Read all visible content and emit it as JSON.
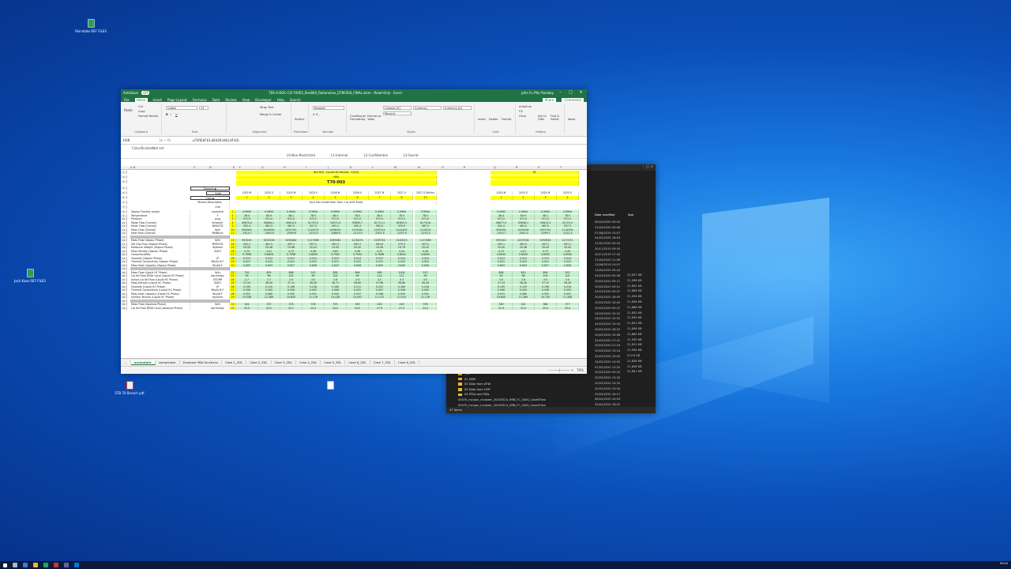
{
  "desktop": {
    "icons": [
      {
        "label": "Reinstate\nREF FILES",
        "style": "g"
      },
      {
        "label": "Jack Kaos\nREF FILES",
        "style": "g"
      },
      {
        "label": "STB 70\nBranch pdf",
        "style": "r"
      },
      {
        "label": "",
        "style": ""
      }
    ]
  },
  "excel": {
    "autosave": "AutoSave",
    "autosave_state": "Off",
    "title": "TEE-A-DOC-CD-70003_RevB04_Rationalise_DT80304_FINAL.xlsm - Read-Only - Excel",
    "user": "John Fu Pfor Rasiday",
    "menu": [
      "File",
      "Home",
      "Insert",
      "Page Layout",
      "Formulas",
      "Data",
      "Review",
      "View",
      "Developer",
      "Help",
      "Search"
    ],
    "share": "Share",
    "comments": "Comments",
    "ribbon": {
      "clipboard": "Clipboard",
      "cut": "Cut",
      "copy": "Copy",
      "format_painter": "Format Painter",
      "paste": "Paste",
      "font_name": "Calibri",
      "font_size": "11",
      "font": "Font",
      "alignment": "Alignment",
      "wrap": "Wrap Text",
      "merge": "Merge & Center",
      "protection": "Protection",
      "protect": "Protect",
      "number": "Number",
      "number_format": "Number",
      "styles": "Styles",
      "style1": "Comma [0]",
      "style2": "Currency",
      "style3": "Currency [0]",
      "style4": "Percent",
      "conditional": "Conditional Formatting",
      "format_table": "Format as Table",
      "cells": "Cells",
      "insert": "Insert",
      "delete": "Delete",
      "format": "Format",
      "editing": "Editing",
      "autosum": "AutoSum",
      "fill": "Fill",
      "clear": "Clear",
      "sort": "Sort & Filter",
      "find": "Find & Select",
      "ideas": "Ideas"
    },
    "name_box": "H18",
    "formula": "=FVIS($F$3,$E$18,H$3,$F$2)",
    "classification_label": "Classification:",
    "classification_value": "Not set",
    "class_tabs": [
      "L0-Non-Restricted",
      "L1-Internal",
      "L2-Confidential",
      "L3-Secret"
    ],
    "columns": [
      "A",
      "B",
      "C",
      "D",
      "E",
      "F",
      "G",
      "H",
      "I",
      "J",
      "K",
      "L",
      "M",
      "N",
      "O",
      "P",
      "Q",
      "R",
      "S",
      "T"
    ],
    "header_rows": {
      "rev": "Rev B04 - Issued for Review - F/S(4)",
      "hba": "HBA",
      "case_id": "T70-003",
      "streams": "Streams ▶",
      "case": "Case ▶",
      "code": "Code",
      "stream_desc": "Stream Description",
      "unit": "Unit",
      "sour_gas": "Sour Gas Outlet from Train 1 to AGR Trains",
      "q_col_code": "F8"
    },
    "year_codes": [
      "2025 M",
      "2025 S",
      "2025 M",
      "2025 S",
      "2026 M",
      "2026 S",
      "2027 M",
      "2027 S",
      "2027 S Stillhrs"
    ],
    "case_nums": [
      "1",
      "2",
      "3",
      "4",
      "5",
      "6",
      "7",
      "8",
      "13"
    ],
    "right_year_codes": [
      "2025 M",
      "2025 S",
      "2025 M",
      "2025 S"
    ],
    "right_case_nums": [
      "1",
      "2",
      "3",
      "4"
    ],
    "rows": [
      {
        "n": "8",
        "label": "Vapour Fraction (mole)",
        "unit": "mole/mol",
        "code": "1",
        "vals": [
          "0.9994",
          "0.9994",
          "0.9994",
          "0.9994",
          "0.9994",
          "0.9994",
          "0.9993",
          "0.9994",
          "0.9994"
        ],
        "r": [
          "0.9992",
          "0.9994",
          "0.9994",
          "0.9994"
        ],
        "style": "green"
      },
      {
        "n": "9",
        "label": "Temperature",
        "unit": "F",
        "code": "2",
        "vals": [
          "46.4",
          "80.9",
          "46.1",
          "78.5",
          "46.4",
          "78.5",
          "46.4",
          "78.5",
          "78.5"
        ],
        "r": [
          "46.4",
          "80.9",
          "46.1",
          "78.5"
        ],
        "style": "green"
      },
      {
        "n": "10",
        "label": "Pressure",
        "unit": "psig",
        "code": "3",
        "vals": [
          "971.0",
          "971.0",
          "971.0",
          "971.0",
          "971.0",
          "971.0",
          "971.0",
          "971.0",
          "971.0"
        ],
        "r": [
          "971.0",
          "971.0",
          "971.0",
          "971.0"
        ],
        "style": "green"
      },
      {
        "n": "11",
        "label": "Molar Flow (Overall)",
        "unit": "lbmole/h",
        "code": "4",
        "vals": [
          "49670.0",
          "50606.1",
          "50614.3",
          "51723.5",
          "54571.0",
          "55895.7",
          "61711.1",
          "62891.3",
          "61715.8"
        ],
        "r": [
          "49677.0",
          "50606.1",
          "50614.3",
          "51723.5"
        ],
        "style": "green"
      },
      {
        "n": "12",
        "label": "Molar Flow (Overall)",
        "unit": "MMSCFD",
        "code": "5",
        "vals": [
          "452.4",
          "461.5",
          "467.0",
          "507.3",
          "491.2",
          "505.4",
          "562.0",
          "570.9",
          "567.3"
        ],
        "r": [
          "452.4",
          "461.5",
          "467.0",
          "507.3"
        ],
        "style": "green"
      },
      {
        "n": "13",
        "label": "Mass Flow (Overall)",
        "unit": "lb/hr",
        "code": "10",
        "vals": [
          "994000",
          "1000000",
          "1051741",
          "1118722",
          "1094002",
          "1131942",
          "1197115",
          "1241403",
          "1118722"
        ],
        "r": [
          "994000",
          "1000194",
          "1051741",
          "1118790"
        ],
        "style": "green"
      },
      {
        "n": "14",
        "label": "Heat Flow (Overall)",
        "unit": "MMBtu/h",
        "code": "11",
        "vals": [
          "-1914.7",
          "-1940.9",
          "-2099.6",
          "-2152.5",
          "-2066.9",
          "-2110.5",
          "-2301.5",
          "-2337.9",
          "-2152.5"
        ],
        "r": [
          "-1914.7",
          "-1941.0",
          "-2099.7",
          "-2152.4"
        ],
        "style": "green"
      },
      {
        "n": "15",
        "label": "",
        "unit": "",
        "code": "",
        "vals": [
          "",
          "",
          "",
          "",
          "",
          "",
          "",
          "",
          ""
        ],
        "r": [
          "",
          "",
          "",
          ""
        ],
        "style": "grey"
      },
      {
        "n": "16",
        "label": "Mass Flow (Vapour Phase)",
        "unit": "lb/hr",
        "code": "13",
        "vals": [
          "993240",
          "1003190",
          "1050482",
          "1117469",
          "1083381",
          "1130474",
          "1195724",
          "1240013",
          "1117469"
        ],
        "r": [
          "993240",
          "1003194",
          "1050504",
          "1117472"
        ],
        "style": "green"
      },
      {
        "n": "17",
        "label": "Std Gas Flow (Vapour Phase)",
        "unit": "MMSCFD",
        "code": "14",
        "vals": [
          "452.1",
          "461.5",
          "497.1",
          "507.2",
          "491.3",
          "505.1",
          "561.6",
          "570.5",
          "507.2"
        ],
        "r": [
          "452.1",
          "461.5",
          "497.1",
          "507.2"
        ],
        "style": "green"
      },
      {
        "n": "18",
        "label": "Molecular Weight (Vapour Phase)",
        "unit": "lb/lbmol",
        "code": "15",
        "vals": [
          "20.00",
          "20.46",
          "19.98",
          "20.42",
          "19.43",
          "20.42",
          "19.40",
          "19.79",
          "20.42"
        ],
        "r": [
          "20.00",
          "20.46",
          "20.00",
          "20.42"
        ],
        "style": "green"
      },
      {
        "n": "19",
        "label": "Mass Density (Vapour Phase)",
        "unit": "lb/ft3",
        "code": "16",
        "vals": [
          "4.73",
          "4.21",
          "4.73",
          "4.26",
          "4.63",
          "4.26",
          "4.72",
          "4.24",
          "4.26"
        ],
        "r": [
          "4.73",
          "4.21",
          "4.73",
          "4.26"
        ],
        "style": "green"
      },
      {
        "n": "20",
        "label": "Compressibility",
        "unit": "-",
        "code": "17",
        "vals": [
          "0.7996",
          "0.8628",
          "0.7996",
          "0.8000",
          "0.7900",
          "0.7994",
          "0.7898",
          "0.8004",
          "0.8000"
        ],
        "r": [
          "0.8000",
          "0.8000",
          "0.8000",
          "0.8000"
        ],
        "style": "green"
      },
      {
        "n": "21",
        "label": "Viscosity (Vapour Phase)",
        "unit": "cP",
        "code": "18",
        "vals": [
          "0.013",
          "0.014",
          "0.013",
          "0.014",
          "0.013",
          "0.014",
          "0.013",
          "0.014",
          "0.014"
        ],
        "r": [
          "0.013",
          "0.014",
          "0.013",
          "0.014"
        ],
        "style": "green"
      },
      {
        "n": "22",
        "label": "Thermal Conductivity (Vapour Phase)",
        "unit": "Btu/hr.ft.F",
        "code": "19",
        "vals": [
          "0.021",
          "0.022",
          "0.021",
          "0.022",
          "0.021",
          "0.022",
          "0.021",
          "0.022",
          "0.022"
        ],
        "r": [
          "0.021",
          "0.022",
          "0.021",
          "0.022"
        ],
        "style": "green"
      },
      {
        "n": "23",
        "label": "Mass Heat Capacity (Vapour Phase)",
        "unit": "Btu/lb.F",
        "code": "20",
        "vals": [
          "0.653",
          "0.633",
          "0.627",
          "0.628",
          "0.647",
          "0.628",
          "0.650",
          "0.640",
          "0.628"
        ],
        "r": [
          "0.653",
          "0.633",
          "0.627",
          "0.628"
        ],
        "style": "green"
      },
      {
        "n": "24",
        "label": "",
        "unit": "",
        "code": "",
        "vals": [
          "",
          "",
          "",
          "",
          "",
          "",
          "",
          "",
          ""
        ],
        "r": [
          "",
          "",
          "",
          ""
        ],
        "style": "grey"
      },
      {
        "n": "25",
        "label": "Mass Flow (Liquid HC Phase)",
        "unit": "lb/hr",
        "code": "22",
        "vals": [
          "792",
          "803",
          "868",
          "913",
          "856",
          "899",
          "965",
          "1004",
          "913"
        ],
        "r": [
          "806",
          "850",
          "894",
          "933"
        ],
        "style": "green"
      },
      {
        "n": "26",
        "label": "Liq Vol Flow @Std Cond (Liquid HC Phase)",
        "unit": "barrel/day",
        "code": "23",
        "vals": [
          "93",
          "96",
          "102",
          "99",
          "102",
          "99",
          "114",
          "111",
          "99"
        ],
        "r": [
          "93",
          "96",
          "105",
          "102"
        ],
        "style": "green"
      },
      {
        "n": "27",
        "label": "Actual Liq Vol Flow (Liquid HC Phase)",
        "unit": "USGPM",
        "code": "24",
        "vals": [
          "2.7",
          "2.7",
          "2.9",
          "3.0",
          "2.8",
          "2.9",
          "3.2",
          "3.3",
          "3.0"
        ],
        "r": [
          "3.0",
          "2.8",
          "3.0",
          "3.0"
        ],
        "style": "green"
      },
      {
        "n": "28",
        "label": "Mass Density (Liquid HC Phase)",
        "unit": "lb/ft3",
        "code": "25",
        "vals": [
          "37.24",
          "36.40",
          "37.11",
          "36.49",
          "36.71",
          "36.60",
          "37.96",
          "36.80",
          "36.49"
        ],
        "r": [
          "37.24",
          "36.40",
          "37.11",
          "36.49"
        ],
        "style": "green"
      },
      {
        "n": "29",
        "label": "Viscosity (Liquid HC Phase)",
        "unit": "cP",
        "code": "26",
        "vals": [
          "0.195",
          "0.120",
          "0.196",
          "0.218",
          "0.189",
          "0.211",
          "0.222",
          "0.160",
          "0.218"
        ],
        "r": [
          "0.195",
          "0.120",
          "0.196",
          "0.218"
        ],
        "style": "green"
      },
      {
        "n": "30",
        "label": "Thermal Conductivity (Liquid HC Phase)",
        "unit": "Btu/hr.ft.F",
        "code": "27",
        "vals": [
          "0.056",
          "0.055",
          "0.056",
          "0.055",
          "0.056",
          "0.055",
          "0.057",
          "0.056",
          "0.055"
        ],
        "r": [
          "0.056",
          "0.055",
          "0.056",
          "0.055"
        ],
        "style": "green"
      },
      {
        "n": "31",
        "label": "Mass Heat Capacity (Liquid HC Phase)",
        "unit": "Btu/lb.F",
        "code": "28",
        "vals": [
          "0.551",
          "0.580",
          "0.552",
          "0.551",
          "0.555",
          "0.557",
          "0.548",
          "0.555",
          "0.551"
        ],
        "r": [
          "0.551",
          "0.580",
          "0.552",
          "0.551"
        ],
        "style": "green"
      },
      {
        "n": "32",
        "label": "Surface Tension (Liquid HC Phase)",
        "unit": "dyne/cm",
        "code": "29",
        "vals": [
          "19.358",
          "11.389",
          "19.630",
          "11.176",
          "19.438",
          "10.931",
          "11.172",
          "11.515",
          "11.176"
        ],
        "r": [
          "19.600",
          "11.389",
          "19.730",
          "11.308"
        ],
        "style": "green"
      },
      {
        "n": "33",
        "label": "",
        "unit": "",
        "code": "",
        "vals": [
          "",
          "",
          "",
          "",
          "",
          "",
          "",
          "",
          ""
        ],
        "r": [
          "",
          "",
          "",
          ""
        ],
        "style": "grey"
      },
      {
        "n": "34",
        "label": "Mass Flow (Aqueous Phase)",
        "unit": "lb/hr",
        "code": "31",
        "vals": [
          "342",
          "337",
          "376",
          "376",
          "375",
          "393",
          "416",
          "416",
          "376"
        ],
        "r": [
          "349",
          "342",
          "384",
          "377"
        ],
        "style": "green"
      },
      {
        "n": "35",
        "label": "Liq Vol Flow @Std Cond (Aqueous Phase)",
        "unit": "barrel/day",
        "code": "32",
        "vals": [
          "22.9",
          "22.2",
          "24.7",
          "24.4",
          "24.0",
          "24.0",
          "27.9",
          "27.3",
          "24.4"
        ],
        "r": [
          "22.9",
          "22.9",
          "25.0",
          "25.0"
        ],
        "style": "green"
      }
    ],
    "sheets": [
      "...",
      "usrInstallr",
      "comparator",
      "Example VBA functions",
      "Case 1_2DL",
      "Case 2_2DL",
      "Case 3_2DL",
      "Case 4_2DL",
      "Case 5_2DL",
      "Case 6_2DL",
      "Case 7_2DL",
      "Case 8_2DL"
    ],
    "active_sheet": 1,
    "zoom": "70%"
  },
  "explorer": {
    "column_header_date": "Date modified",
    "column_header_size": "Size",
    "dates": [
      "08/04/2020 09:03",
      "21/04/2020 09:08",
      "07/08/2019 15:07",
      "04/03/2020 16:04",
      "21/02/2020 09:54",
      "20/11/2019 09:30",
      "20/11/2019 17:43",
      "21/04/2020 11:08",
      "12/06/2019 10:57",
      "13/04/2020 09:43",
      "24/03/2020 09:28",
      "20/03/2020 09:21",
      "20/03/2020 09:51",
      "24/03/2020 09:47",
      "20/03/2020 16:05",
      "20/03/2020 10:40",
      "20/03/2020 09:47",
      "24/03/2020 10:32",
      "24/03/2020 10:52",
      "24/03/2020 10:33",
      "20/03/2020 16:52",
      "20/03/2020 10:08",
      "24/03/2020 17:41",
      "20/03/2020 21:18",
      "20/03/2020 10:24",
      "24/03/2020 14:00",
      "24/03/2020 14:00",
      "07/05/2020 15:52",
      "20/03/2020 09:20",
      "20/03/2020 13:34",
      "20/03/2020 14:30",
      "20/03/2020 19:34",
      "20/03/2020 16:27",
      "08/04/2020 10:03",
      "03/04/2020 16:02",
      "03/04/2020 16:15",
      "08/04/2020 16:21"
    ],
    "sizes": [
      "22,837 KB",
      "22,098 KB",
      "21,692 KB",
      "21,868 KB",
      "21,926 KB",
      "21,836 KB",
      "21,868 KB",
      "21,832 KB",
      "21,839 KB",
      "21,822 KB",
      "21,856 KB",
      "21,860 KB",
      "21,930 KB",
      "21,812 KB",
      "21,956 KB",
      "2,074 KB",
      "21,828 KB",
      "21,826 KB",
      "21,801 KB"
    ],
    "files": [
      {
        "name": "_old",
        "type": "folder"
      },
      {
        "name": "01 HMB",
        "type": "folder"
      },
      {
        "name": "02 Data from AFW",
        "type": "folder"
      },
      {
        "name": "03 Data from UOP",
        "type": "folder"
      },
      {
        "name": "04 PFDs and PIDs",
        "type": "folder"
      },
      {
        "name": "00070_mcnjon_mcaster_20200324_HRB_FC_GWG_Case8Flexi",
        "type": "file"
      },
      {
        "name": "00070_mcnjon_mcaster_20200324_HRB_FC_GWG_Case4Flexi",
        "type": "file"
      },
      {
        "name": "00070_mcnjon_mcaster_20200324_HRB_FC_GWG_Case5Flexi",
        "type": "file"
      },
      {
        "name": "00070_mcnjon_mcaster_20200324_HRB_FC_GWG_Rationalist_FINAL.xlsm",
        "type": "file"
      },
      {
        "name": "00070_mcnjon_mcaster_20200324_HRB_FC_GWG_Case6Flexi",
        "type": "file"
      },
      {
        "name": "00070_mcnjon_mcaster_20200409_HRB_FC_GWG_Case8Flexi0",
        "type": "file"
      },
      {
        "name": "00070_mcnjon_mcaster_20200409_HRB_FC_GWG_Case8 alternate_mcontrol.flexi",
        "type": "file"
      }
    ],
    "status": "47 items"
  },
  "taskbar": {
    "clock": "09:04"
  }
}
